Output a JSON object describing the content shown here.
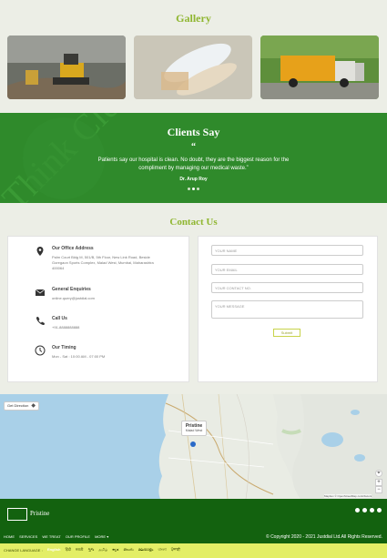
{
  "gallery": {
    "title": "Gallery"
  },
  "clients": {
    "title": "Clients Say",
    "quote_mark": "“",
    "text": "Patients say our hospital is clean. No doubt, they are the biggest reason for the compliment by managing our medical waste.”",
    "author": "Dr. Arup Roy"
  },
  "contact": {
    "title": "Contact Us",
    "office_label": "Our Office Address",
    "office_value": "Palm Court Bldg M, 501/B, 5th Floor, New Link Road, Beside Goregaon Sports Complex, Malad West, Mumbai, Maharashtra 400064",
    "enquiries_label": "General Enquiries",
    "enquiries_value": "online.query@justdial.com",
    "call_label": "Call Us",
    "call_value": "+91-8888888888",
    "timing_label": "Our Timing",
    "timing_value": "Mon - Sat : 10:00 AM - 07:00 PM",
    "form": {
      "name_placeholder": "YOUR NAME",
      "email_placeholder": "YOUR EMAIL",
      "contact_placeholder": "YOUR CONTACT NO.",
      "message_placeholder": "YOUR MESSAGE",
      "submit_label": "Submit"
    }
  },
  "map": {
    "direction_button": "Get Direction",
    "pin_title": "Pristine",
    "pin_subtitle": "Malad West",
    "zoom_in": "+",
    "zoom_out": "−",
    "attribution": "Mapbox © OpenStreetMap contributors"
  },
  "footer": {
    "brand": "Pristine",
    "nav": [
      "HOME",
      "SERVICES",
      "WE TREAT",
      "OUR PROFILE",
      "MORE ▾"
    ],
    "copyright": "© Copyright 2020 - 2021 Justdial Ltd.All Rights Reserved."
  },
  "language_bar": {
    "label": "CHANGE LANGUAGE :",
    "languages": [
      "English",
      "हिंदी",
      "मराठी",
      "ગુજ",
      "தமிழ்",
      "ಕನ್ನಡ",
      "తెలుగు",
      "മലയാളം",
      "বাংলা",
      "ਪੰਜਾਬੀ"
    ],
    "active": "English"
  },
  "colors": {
    "brand_green": "#13620f",
    "accent_lime": "#8fb630",
    "slider_green": "#2e8a2a",
    "lang_bar": "#e3ee66"
  }
}
